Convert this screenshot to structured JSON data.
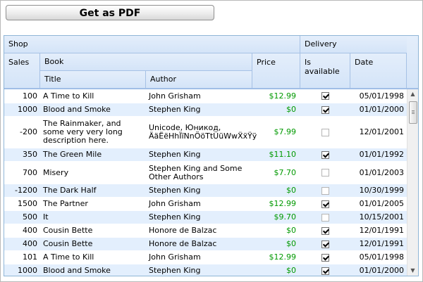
{
  "toolbar": {
    "pdf_button_label": "Get as PDF"
  },
  "grid": {
    "header": {
      "shop": "Shop",
      "sales": "Sales",
      "book": "Book",
      "title": "Title",
      "author": "Author",
      "price": "Price",
      "delivery": "Delivery",
      "is_available": "Is available",
      "date": "Date"
    },
    "rows": [
      {
        "sales": "100",
        "title": "A Time to Kill",
        "author": "John Grisham",
        "price": "$12.99",
        "available": true,
        "date": "05/01/1998"
      },
      {
        "sales": "1000",
        "title": "Blood and Smoke",
        "author": "Stephen King",
        "price": "$0",
        "available": true,
        "date": "01/01/2000"
      },
      {
        "sales": "-200",
        "title": "The Rainmaker, and some very very long description here.",
        "author": "Unicode, Юникод, ÄäËëHhÏïNnÖöTtÜüWwẌẍŸÿ",
        "price": "$7.99",
        "available": false,
        "date": "12/01/2001"
      },
      {
        "sales": "350",
        "title": "The Green Mile",
        "author": "Stephen King",
        "price": "$11.10",
        "available": true,
        "date": "01/01/1992"
      },
      {
        "sales": "700",
        "title": "Misery",
        "author": "Stephen King and Some Other Authors",
        "price": "$7.70",
        "available": false,
        "date": "01/01/2003"
      },
      {
        "sales": "-1200",
        "title": "The Dark Half",
        "author": "Stephen King",
        "price": "$0",
        "available": false,
        "date": "10/30/1999"
      },
      {
        "sales": "1500",
        "title": "The Partner",
        "author": "John Grisham",
        "price": "$12.99",
        "available": true,
        "date": "01/01/2005"
      },
      {
        "sales": "500",
        "title": "It",
        "author": "Stephen King",
        "price": "$9.70",
        "available": false,
        "date": "10/15/2001"
      },
      {
        "sales": "400",
        "title": "Cousin Bette",
        "author": "Honore de Balzac",
        "price": "$0",
        "available": true,
        "date": "12/01/1991"
      },
      {
        "sales": "400",
        "title": "Cousin Bette",
        "author": "Honore de Balzac",
        "price": "$0",
        "available": true,
        "date": "12/01/1991"
      },
      {
        "sales": "101",
        "title": "A Time to Kill",
        "author": "John Grisham",
        "price": "$12.99",
        "available": true,
        "date": "05/01/1998"
      },
      {
        "sales": "1000",
        "title": "Blood and Smoke",
        "author": "Stephen King",
        "price": "$0",
        "available": true,
        "date": "01/01/2000"
      }
    ],
    "scroll_position": 0.0
  },
  "colors": {
    "header_bg": "#d9e8fb",
    "alt_row_bg": "#e3effd",
    "price_text": "#009900"
  }
}
